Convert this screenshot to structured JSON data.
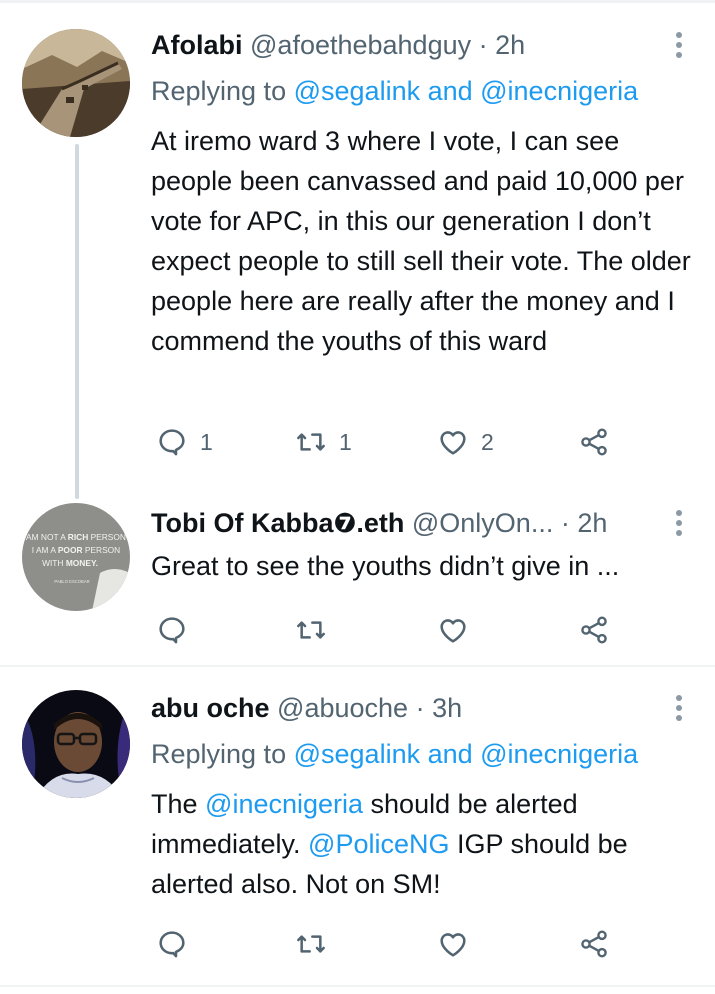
{
  "tweets": [
    {
      "name": "Afolabi",
      "handle": "@afoethebahdguy",
      "time": "· 2h",
      "reply_label": "Replying to",
      "reply_targets": "@segalink and @inecnigeria",
      "text": "At iremo ward 3 where I vote, I can see people been canvassed and paid 10,000 per vote for APC, in this our generation I don’t expect people to still sell their vote. The older people here are really after the money and I commend the youths of this ward",
      "replies": "1",
      "retweets": "1",
      "likes": "2"
    },
    {
      "name": "Tobi Of Kabba❼.eth",
      "handle": "@OnlyOn...",
      "time": "· 2h",
      "text": "Great to see the youths didn’t give in ...",
      "avatar_text": {
        "line1a": "AM NOT A ",
        "line1b": "RICH",
        "line1c": " PERSON",
        "line2a": "I AM A ",
        "line2b": "POOR",
        "line2c": " PERSON",
        "line3a": "WITH ",
        "line3b": "MONEY.",
        "line4": "PABLO ESCOBAR"
      }
    },
    {
      "name": "abu oche",
      "handle": "@abuoche",
      "time": "· 3h",
      "reply_label": "Replying to",
      "reply_targets": "@segalink and @inecnigeria",
      "text_parts": [
        "The ",
        "@inecnigeria",
        " should be alerted immediately. ",
        "@PoliceNG",
        " IGP should be alerted also. Not on SM!"
      ]
    }
  ],
  "colors": {
    "link": "#1d9bf0",
    "secondary_text": "#536471",
    "primary_text": "#0f1419",
    "divider": "#eff3f4",
    "thread_line": "#cfd9de"
  },
  "icons": [
    "reply-icon",
    "retweet-icon",
    "like-icon",
    "share-icon",
    "more-icon"
  ]
}
